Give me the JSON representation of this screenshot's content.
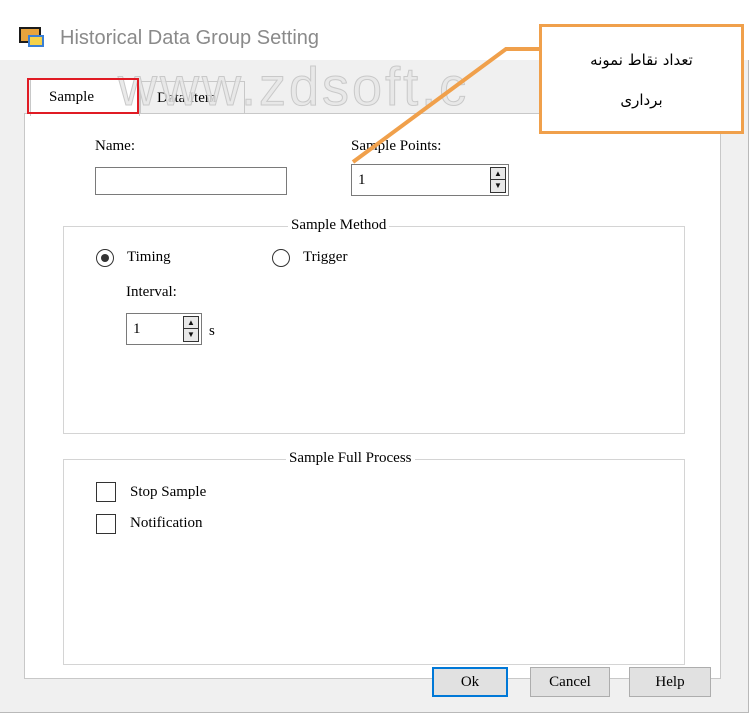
{
  "window": {
    "title": "Historical Data Group Setting",
    "icon": "app-icon"
  },
  "watermark": "www.zdsoft.c",
  "tabs": [
    {
      "label": "Sample",
      "active": true
    },
    {
      "label": "Data Item",
      "active": false
    }
  ],
  "sample": {
    "name_label": "Name:",
    "name_value": "",
    "sample_points_label": "Sample Points:",
    "sample_points_value": "1",
    "method_group": {
      "title": "Sample Method",
      "timing_label": "Timing",
      "timing_selected": true,
      "trigger_label": "Trigger",
      "trigger_selected": false,
      "interval_label": "Interval:",
      "interval_value": "1",
      "interval_unit": "s"
    },
    "full_group": {
      "title": "Sample Full Process",
      "stop_sample_label": "Stop Sample",
      "stop_sample_checked": false,
      "notification_label": "Notification",
      "notification_checked": false
    }
  },
  "buttons": {
    "ok": "Ok",
    "cancel": "Cancel",
    "help": "Help"
  },
  "annotation": {
    "line1": "تعداد نقاط نمونه",
    "line2": "برداری",
    "border_color": "#f0a04b",
    "highlight_color": "#e01b24"
  }
}
